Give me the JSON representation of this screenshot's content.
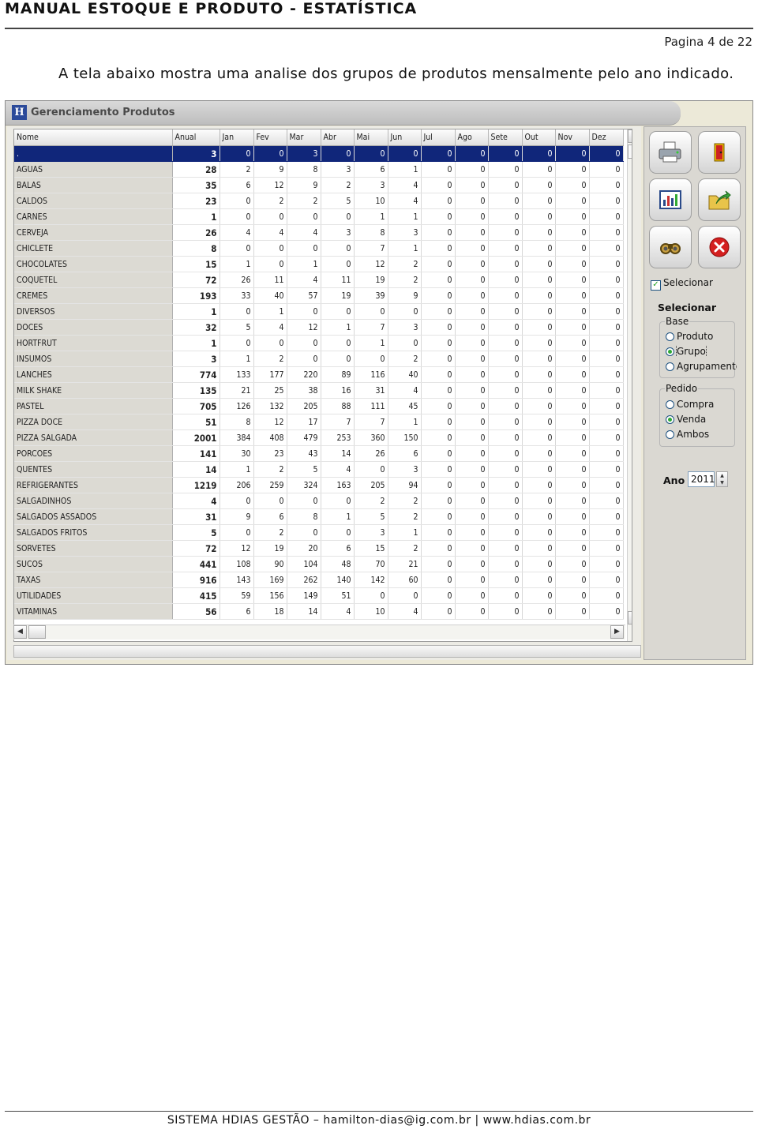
{
  "doc": {
    "title": "MANUAL ESTOQUE E PRODUTO - ESTATÍSTICA",
    "page": "Pagina 4 de 22",
    "intro": "A tela abaixo mostra uma analise dos grupos de produtos mensalmente pelo ano indicado.",
    "footer": "SISTEMA HDIAS GESTÃO – hamilton-dias@ig.com.br | www.hdias.com.br"
  },
  "window": {
    "title": "Gerenciamento Produtos"
  },
  "grid": {
    "columns": [
      "Nome",
      "Anual",
      "Jan",
      "Fev",
      "Mar",
      "Abr",
      "Mai",
      "Jun",
      "Jul",
      "Ago",
      "Sete",
      "Out",
      "Nov",
      "Dez"
    ],
    "rows": [
      [
        ".",
        "3",
        "0",
        "0",
        "3",
        "0",
        "0",
        "0",
        "0",
        "0",
        "0",
        "0",
        "0",
        "0"
      ],
      [
        "AGUAS",
        "28",
        "2",
        "9",
        "8",
        "3",
        "6",
        "1",
        "0",
        "0",
        "0",
        "0",
        "0",
        "0"
      ],
      [
        "BALAS",
        "35",
        "6",
        "12",
        "9",
        "2",
        "3",
        "4",
        "0",
        "0",
        "0",
        "0",
        "0",
        "0"
      ],
      [
        "CALDOS",
        "23",
        "0",
        "2",
        "2",
        "5",
        "10",
        "4",
        "0",
        "0",
        "0",
        "0",
        "0",
        "0"
      ],
      [
        "CARNES",
        "1",
        "0",
        "0",
        "0",
        "0",
        "1",
        "1",
        "0",
        "0",
        "0",
        "0",
        "0",
        "0"
      ],
      [
        "CERVEJA",
        "26",
        "4",
        "4",
        "4",
        "3",
        "8",
        "3",
        "0",
        "0",
        "0",
        "0",
        "0",
        "0"
      ],
      [
        "CHICLETE",
        "8",
        "0",
        "0",
        "0",
        "0",
        "7",
        "1",
        "0",
        "0",
        "0",
        "0",
        "0",
        "0"
      ],
      [
        "CHOCOLATES",
        "15",
        "1",
        "0",
        "1",
        "0",
        "12",
        "2",
        "0",
        "0",
        "0",
        "0",
        "0",
        "0"
      ],
      [
        "COQUETEL",
        "72",
        "26",
        "11",
        "4",
        "11",
        "19",
        "2",
        "0",
        "0",
        "0",
        "0",
        "0",
        "0"
      ],
      [
        "CREMES",
        "193",
        "33",
        "40",
        "57",
        "19",
        "39",
        "9",
        "0",
        "0",
        "0",
        "0",
        "0",
        "0"
      ],
      [
        "DIVERSOS",
        "1",
        "0",
        "1",
        "0",
        "0",
        "0",
        "0",
        "0",
        "0",
        "0",
        "0",
        "0",
        "0"
      ],
      [
        "DOCES",
        "32",
        "5",
        "4",
        "12",
        "1",
        "7",
        "3",
        "0",
        "0",
        "0",
        "0",
        "0",
        "0"
      ],
      [
        "HORTFRUT",
        "1",
        "0",
        "0",
        "0",
        "0",
        "1",
        "0",
        "0",
        "0",
        "0",
        "0",
        "0",
        "0"
      ],
      [
        "INSUMOS",
        "3",
        "1",
        "2",
        "0",
        "0",
        "0",
        "2",
        "0",
        "0",
        "0",
        "0",
        "0",
        "0"
      ],
      [
        "LANCHES",
        "774",
        "133",
        "177",
        "220",
        "89",
        "116",
        "40",
        "0",
        "0",
        "0",
        "0",
        "0",
        "0"
      ],
      [
        "MILK SHAKE",
        "135",
        "21",
        "25",
        "38",
        "16",
        "31",
        "4",
        "0",
        "0",
        "0",
        "0",
        "0",
        "0"
      ],
      [
        "PASTEL",
        "705",
        "126",
        "132",
        "205",
        "88",
        "111",
        "45",
        "0",
        "0",
        "0",
        "0",
        "0",
        "0"
      ],
      [
        "PIZZA DOCE",
        "51",
        "8",
        "12",
        "17",
        "7",
        "7",
        "1",
        "0",
        "0",
        "0",
        "0",
        "0",
        "0"
      ],
      [
        "PIZZA SALGADA",
        "2001",
        "384",
        "408",
        "479",
        "253",
        "360",
        "150",
        "0",
        "0",
        "0",
        "0",
        "0",
        "0"
      ],
      [
        "PORCOES",
        "141",
        "30",
        "23",
        "43",
        "14",
        "26",
        "6",
        "0",
        "0",
        "0",
        "0",
        "0",
        "0"
      ],
      [
        "QUENTES",
        "14",
        "1",
        "2",
        "5",
        "4",
        "0",
        "3",
        "0",
        "0",
        "0",
        "0",
        "0",
        "0"
      ],
      [
        "REFRIGERANTES",
        "1219",
        "206",
        "259",
        "324",
        "163",
        "205",
        "94",
        "0",
        "0",
        "0",
        "0",
        "0",
        "0"
      ],
      [
        "SALGADINHOS",
        "4",
        "0",
        "0",
        "0",
        "0",
        "2",
        "2",
        "0",
        "0",
        "0",
        "0",
        "0",
        "0"
      ],
      [
        "SALGADOS ASSADOS",
        "31",
        "9",
        "6",
        "8",
        "1",
        "5",
        "2",
        "0",
        "0",
        "0",
        "0",
        "0",
        "0"
      ],
      [
        "SALGADOS FRITOS",
        "5",
        "0",
        "2",
        "0",
        "0",
        "3",
        "1",
        "0",
        "0",
        "0",
        "0",
        "0",
        "0"
      ],
      [
        "SORVETES",
        "72",
        "12",
        "19",
        "20",
        "6",
        "15",
        "2",
        "0",
        "0",
        "0",
        "0",
        "0",
        "0"
      ],
      [
        "SUCOS",
        "441",
        "108",
        "90",
        "104",
        "48",
        "70",
        "21",
        "0",
        "0",
        "0",
        "0",
        "0",
        "0"
      ],
      [
        "TAXAS",
        "916",
        "143",
        "169",
        "262",
        "140",
        "142",
        "60",
        "0",
        "0",
        "0",
        "0",
        "0",
        "0"
      ],
      [
        "UTILIDADES",
        "415",
        "59",
        "156",
        "149",
        "51",
        "0",
        "0",
        "0",
        "0",
        "0",
        "0",
        "0",
        "0"
      ],
      [
        "VITAMINAS",
        "56",
        "6",
        "18",
        "14",
        "4",
        "10",
        "4",
        "0",
        "0",
        "0",
        "0",
        "0",
        "0"
      ]
    ],
    "selected_row": 0
  },
  "panel": {
    "tools": [
      "printer-icon",
      "exit-door-icon",
      "chart-icon",
      "export-folder-icon",
      "binoculars-icon",
      "close-icon"
    ],
    "selecionar_check": "Selecionar",
    "group_title": "Selecionar",
    "base": {
      "title": "Base",
      "options": [
        "Produto",
        "Grupo",
        "Agrupamento"
      ],
      "selected": "Grupo"
    },
    "pedido": {
      "title": "Pedido",
      "options": [
        "Compra",
        "Venda",
        "Ambos"
      ],
      "selected": "Venda"
    },
    "ano_label": "Ano",
    "ano_value": "2011"
  }
}
